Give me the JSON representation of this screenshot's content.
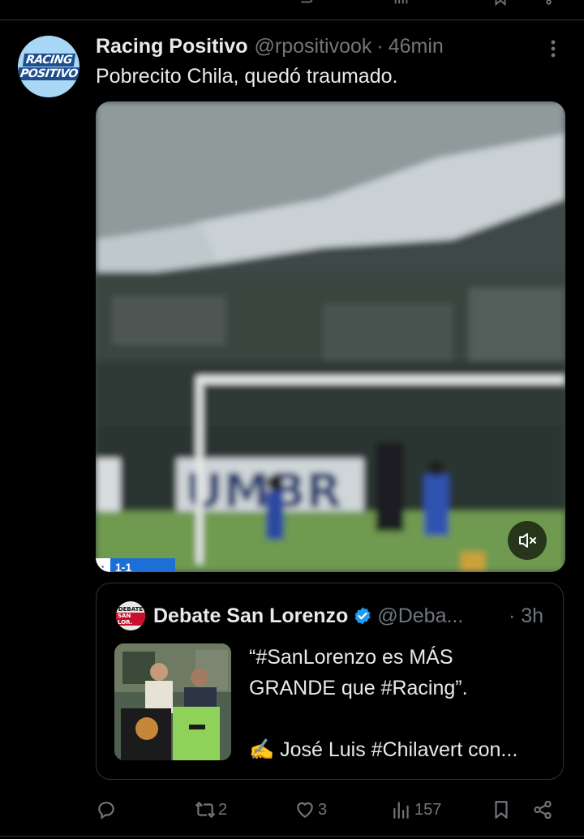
{
  "tweet": {
    "author_name": "Racing Positivo",
    "author_handle": "@rpositivook",
    "separator": "·",
    "time": "46min",
    "text": "Pobrecito Chila, quedó traumado.",
    "avatar_text": [
      "RACING",
      "POSITIVO"
    ],
    "video": {
      "score_badge": "1-1",
      "mute_icon": "speaker-muted-icon"
    }
  },
  "quoted_tweet": {
    "author_name": "Debate San Lorenzo",
    "author_handle": "@Deba...",
    "separator": "·",
    "time": "3h",
    "avatar_text": [
      "DEBATE",
      "SAN LOR."
    ],
    "text_line1": "“#SanLorenzo es MÁS",
    "text_line2": "GRANDE que #Racing”.",
    "text_line3": "✍️ José Luis #Chilavert con...",
    "verified_color": "#1d9bf0"
  },
  "actions": {
    "reply_count": "",
    "retweet_count": "2",
    "like_count": "3",
    "views_count": "157"
  },
  "colors": {
    "background": "#000000",
    "primary_text": "#e7e9ea",
    "secondary_text": "#71767b",
    "border": "#2f3336"
  }
}
